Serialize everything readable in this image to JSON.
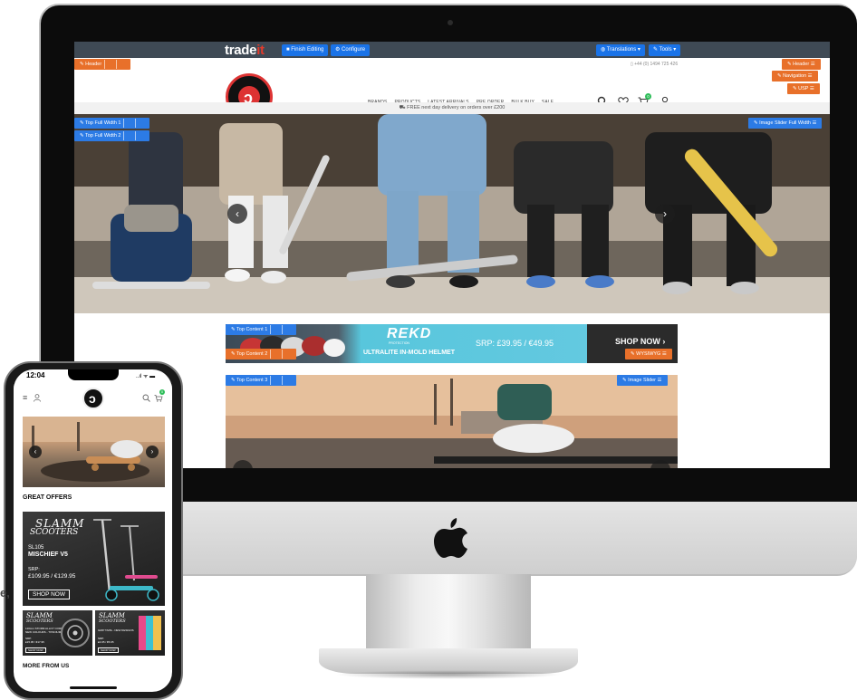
{
  "admin": {
    "brand_main": "trade",
    "brand_accent": "it",
    "finish_editing": "Finish Editing",
    "configure": "Configure",
    "translations": "Translations",
    "tools": "Tools"
  },
  "edit_tags": {
    "header_left": "Header",
    "header_right": "Header",
    "navigation": "Navigation",
    "usp": "USP",
    "top_full_width_1": "Top Full Width 1",
    "top_full_width_2": "Top Full Width 2",
    "image_slider_full_width": "Image Slider Full Width",
    "top_content_1": "Top Content 1",
    "top_content_2": "Top Content 2",
    "top_content_3": "Top Content 3",
    "image_slider": "Image Slider",
    "wysiwyg": "WYSIWYG"
  },
  "header": {
    "phone": "+44 (0) 1494 725 426",
    "nav": [
      "BRANDS",
      "PRODUCTS",
      "LATEST ARRIVALS",
      "PRE ORDER",
      "BULK BUY",
      "SALE"
    ],
    "cart_count": "0"
  },
  "usp": {
    "text": "FREE next day delivery on orders over £200"
  },
  "helmet_banner": {
    "brand": "REKD",
    "brand_sub": "PROTECTION",
    "product": "ULTRALITE IN-MOLD HELMET",
    "price": "SRP: £39.95 / €49.95",
    "cta": "SHOP NOW"
  },
  "phone": {
    "time": "12:04",
    "status": "..ıl ᯤ ▬",
    "cart_count": "0",
    "great_offers": "GREAT OFFERS",
    "promo_brand_1": "SLAMM",
    "promo_brand_2": "SCOOTERS",
    "promo_code": "SL105",
    "promo_name": "MISCHIEF V5",
    "promo_price_label": "SRP:",
    "promo_price": "£109.95 / €129.95",
    "promo_cta": "SHOP NOW",
    "small1_brand": "SLAMM",
    "small1_sub": "SCOOTERS",
    "small1_line1": "110mm STORM ALLOY CORE",
    "small1_line2": "NEW COLOURS - TITANIUM",
    "small1_price_label": "SRP:",
    "small1_price": "£15.95 / €17.95",
    "small1_cta": "SHOP NOW",
    "small2_brand": "SLAMM",
    "small2_sub": "SCOOTERS",
    "small2_line1": "GRIP TAPE - NEW DESIGNS",
    "small2_price_label": "SRP:",
    "small2_price": "£4.95 / €5.95",
    "small2_cta": "SHOP NOW",
    "more_from_us": "MORE FROM US"
  },
  "page_fragment": "e,",
  "colors": {
    "admin_bar": "#3f4a55",
    "edit_orange": "#e8702a",
    "edit_blue": "#2c7be5",
    "brand_red": "#e23b2c",
    "banner_cyan": "#58c6dc"
  }
}
